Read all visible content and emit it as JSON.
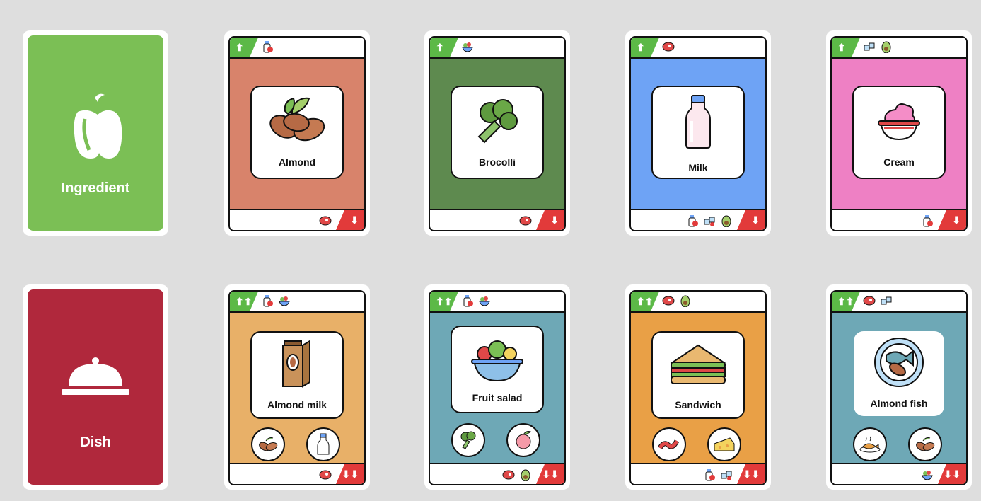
{
  "categories": {
    "ingredient": {
      "label": "Ingredient",
      "color": "#7bbf55",
      "icon": "bell-pepper-icon"
    },
    "dish": {
      "label": "Dish",
      "color": "#b0283c",
      "icon": "cloche-icon"
    }
  },
  "ingredient_cards": [
    {
      "name": "Almond",
      "bg": "#d8836b",
      "icon": "almond-icon"
    },
    {
      "name": "Brocolli",
      "bg": "#5e8a4f",
      "icon": "broccoli-icon"
    },
    {
      "name": "Milk",
      "bg": "#6ea3f5",
      "icon": "milk-bottle-icon"
    },
    {
      "name": "Cream",
      "bg": "#ee80c4",
      "icon": "cream-bowl-icon"
    }
  ],
  "dish_cards": [
    {
      "name": "Almond milk",
      "bg": "#e8b068",
      "icon": "almond-milk-carton-icon"
    },
    {
      "name": "Fruit salad",
      "bg": "#6ea8b6",
      "icon": "fruit-salad-icon"
    },
    {
      "name": "Sandwich",
      "bg": "#e9a046",
      "icon": "sandwich-icon"
    },
    {
      "name": "Almond fish",
      "bg": "#6ea8b6",
      "icon": "almond-fish-icon"
    }
  ],
  "colors": {
    "up": "#5cb947",
    "down": "#e23a3a",
    "background": "#dedede"
  },
  "arrows": {
    "up": "⬆",
    "down": "⬇",
    "double_up": "⬆⬆",
    "double_down": "⬇⬇"
  }
}
